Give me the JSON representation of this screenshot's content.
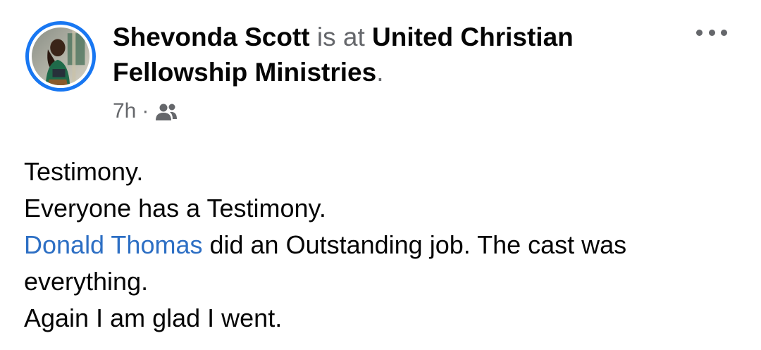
{
  "post": {
    "author": "Shevonda Scott",
    "is_at": "is at",
    "location_line1": "United Christian",
    "location_line2": "Fellowship Ministries",
    "location_end": ".",
    "time": "7h",
    "separator": "·",
    "audience_icon": "friends-icon",
    "more_icon": "more-horizontal-icon",
    "body": {
      "line1": "Testimony.",
      "line2": "Everyone has a Testimony.",
      "mention": "Donald Thomas",
      "line3_rest": " did an Outstanding job. The cast was",
      "line4": "everything.",
      "line5": "Again I am glad I went."
    },
    "colors": {
      "avatar_ring": "#1877f2",
      "mention": "#2d6fc4",
      "muted": "#65676b"
    }
  }
}
